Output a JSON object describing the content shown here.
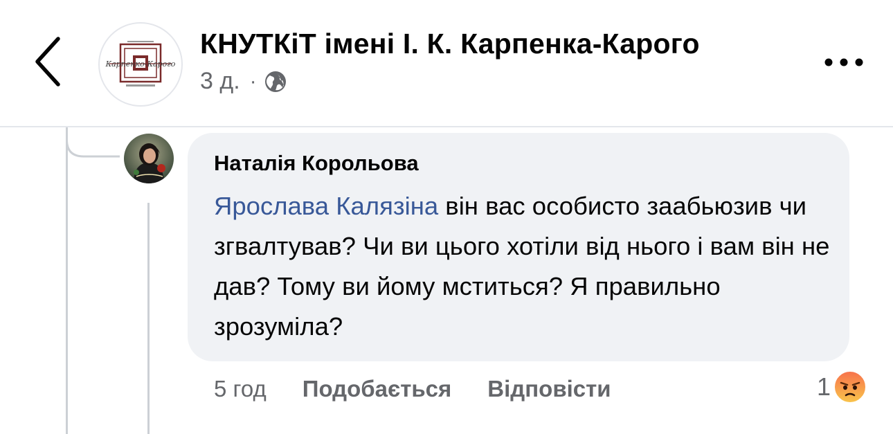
{
  "header": {
    "page_name": "КНУТКіТ імені І. К. Карпенка-Карого",
    "post_time": "3 д.",
    "separator": "·",
    "logo_text": "Карпенко-Карого",
    "audience_icon": "globe-icon"
  },
  "comment": {
    "author": "Наталія Корольова",
    "mention": "Ярослава Калязіна",
    "text": " він вас особисто заабьюзив чи згвалтував? Чи ви цього хотіли від нього і вам він не дав? Тому ви йому мститься? Я правильно зрозуміла?",
    "time": "5 год",
    "like_label": "Подобається",
    "reply_label": "Відповісти",
    "reaction_count": "1",
    "reaction_icon": "angry-reaction-icon"
  },
  "colors": {
    "mention": "#385898",
    "bubble": "#f0f2f5",
    "secondary_text": "#65676b",
    "angry_top": "#f7714c",
    "angry_bottom": "#f9c54b"
  }
}
